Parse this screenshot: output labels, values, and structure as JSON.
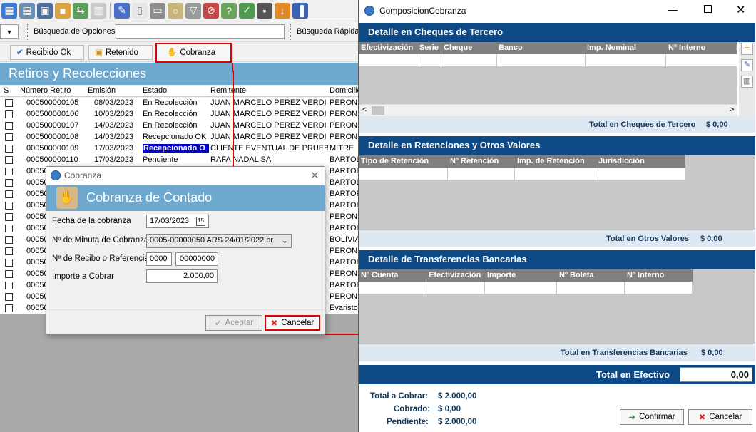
{
  "app": {
    "search_label": "Búsqueda de Opciones",
    "quick_search_label": "Búsqueda Rápida",
    "actions": {
      "recibido_ok": "Recibido Ok",
      "retenido": "Retenido",
      "cobranza": "Cobranza"
    },
    "section_title": "Retiros y Recolecciones",
    "columns": [
      "S",
      "Número Retiro",
      "Emisión",
      "Estado",
      "Remitente",
      "Domicilio"
    ],
    "rows": [
      {
        "numero": "000500000105",
        "emision": "08/03/2023",
        "estado": "En Recolección",
        "remitente": "JUAN MARCELO PEREZ VERDI",
        "domicilio": "PERON"
      },
      {
        "numero": "000500000106",
        "emision": "10/03/2023",
        "estado": "En Recolección",
        "remitente": "JUAN MARCELO PEREZ VERDI",
        "domicilio": "PERON"
      },
      {
        "numero": "000500000107",
        "emision": "14/03/2023",
        "estado": "En Recolección",
        "remitente": "JUAN MARCELO PEREZ VERDI",
        "domicilio": "PERON"
      },
      {
        "numero": "000500000108",
        "emision": "14/03/2023",
        "estado": "Recepcionado OK",
        "remitente": "JUAN MARCELO PEREZ VERDI",
        "domicilio": "PERON"
      },
      {
        "numero": "000500000109",
        "emision": "17/03/2023",
        "estado": "Recepcionado O",
        "remitente": "CLIENTE EVENTUAL DE PRUEBA",
        "domicilio": "MITRE"
      },
      {
        "numero": "000500000110",
        "emision": "17/03/2023",
        "estado": "Pendiente",
        "remitente": "RAFA NADAL SA",
        "domicilio": "BARTOL"
      },
      {
        "numero": "00050",
        "domicilio": "BARTOL"
      },
      {
        "numero": "00050",
        "domicilio": "BARTOL"
      },
      {
        "numero": "00050",
        "domicilio": "BARTOP"
      },
      {
        "numero": "00050",
        "domicilio": "BARTOL"
      },
      {
        "numero": "00050",
        "domicilio": "PERON"
      },
      {
        "numero": "00050",
        "domicilio": "BARTOL"
      },
      {
        "numero": "00050",
        "domicilio": "BOLIVIA"
      },
      {
        "numero": "00050",
        "domicilio": "PERON"
      },
      {
        "numero": "00050",
        "domicilio": "BARTOL"
      },
      {
        "numero": "00050",
        "domicilio": "PERON"
      },
      {
        "numero": "00050",
        "domicilio": "BARTOL"
      },
      {
        "numero": "00050",
        "domicilio": "PERON"
      },
      {
        "numero": "00050",
        "domicilio": "Evaristo"
      }
    ]
  },
  "cobranza_dialog": {
    "window_title": "Cobranza",
    "header": "Cobranza de Contado",
    "fecha_label": "Fecha de la cobranza",
    "fecha_value": "17/03/2023",
    "minuta_label": "Nº de Minuta de Cobranza",
    "minuta_value": "0005-00000050  ARS  24/01/2022  pr",
    "recibo_label": "Nº de Recibo o Referencia",
    "recibo_prefix": "0000",
    "recibo_number": "00000000",
    "importe_label": "Importe a Cobrar",
    "importe_value": "2.000,00",
    "accept": "Aceptar",
    "cancel": "Cancelar"
  },
  "composicion": {
    "window_title": "ComposicionCobranza",
    "cheques": {
      "title": "Detalle en Cheques de Tercero",
      "columns": [
        "Efectivización",
        "Serie",
        "Cheque",
        "Banco",
        "Imp. Nominal",
        "Nº Interno",
        "I"
      ],
      "total_label": "Total en Cheques de Tercero",
      "total_value": "$ 0,00"
    },
    "retenciones": {
      "title": "Detalle en Retenciones y Otros Valores",
      "columns": [
        "Tipo de Retención",
        "Nº Retención",
        "Imp. de Retención",
        "Jurisdicción"
      ],
      "total_label": "Total en Otros Valores",
      "total_value": "$ 0,00"
    },
    "transferencias": {
      "title": "Detalle de Transferencias Bancarias",
      "columns": [
        "Nº Cuenta",
        "Efectivización",
        "Importe",
        "Nº Boleta",
        "Nº Interno"
      ],
      "total_label": "Total en Transferencias Bancarias",
      "total_value": "$ 0,00"
    },
    "efectivo_label": "Total en Efectivo",
    "efectivo_value": "0,00",
    "summary": {
      "total_label": "Total a Cobrar:",
      "total_value": "$ 2.000,00",
      "cobrado_label": "Cobrado:",
      "cobrado_value": "$ 0,00",
      "pendiente_label": "Pendiente:",
      "pendiente_value": "$ 2.000,00"
    },
    "confirm": "Confirmar",
    "cancel": "Cancelar"
  },
  "colors": {
    "accent_blue": "#6fa8cf",
    "dark_blue": "#0d4a85",
    "highlight": "#e00000"
  }
}
